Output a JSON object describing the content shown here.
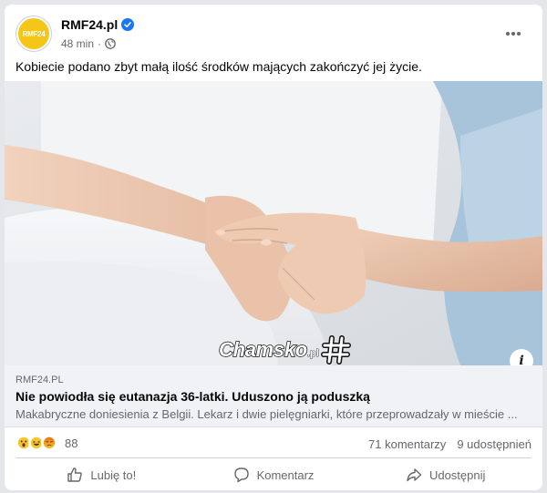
{
  "post": {
    "page_name": "RMF24.pl",
    "avatar_text": "RMF24",
    "time": "48 min",
    "separator": "·",
    "text": "Kobiecie podano zbyt małą ilość środków mających zakończyć jej życie."
  },
  "image": {
    "watermark_main": "Chamsko",
    "watermark_sub": ".pl",
    "info_label": "i"
  },
  "link": {
    "domain": "RMF24.PL",
    "title": "Nie powiodła się eutanazja 36-latki. Uduszono ją poduszką",
    "description": "Makabryczne doniesienia z Belgii. Lekarz i dwie pielęgniarki, które przeprowadzały w mieście ..."
  },
  "stats": {
    "reaction_count": "88",
    "comments": "71 komentarzy",
    "shares": "9 udostępnień"
  },
  "actions": {
    "like": "Lubię to!",
    "comment": "Komentarz",
    "share": "Udostępnij"
  },
  "colors": {
    "accent": "#1877f2",
    "avatar_bg": "#f5c518",
    "muted_text": "#65676b"
  },
  "icons": [
    "verified-badge-icon",
    "globe-icon",
    "more-options-icon",
    "info-icon",
    "wow-reaction-icon",
    "haha-reaction-icon",
    "angry-reaction-icon",
    "like-icon",
    "comment-icon",
    "share-icon"
  ]
}
